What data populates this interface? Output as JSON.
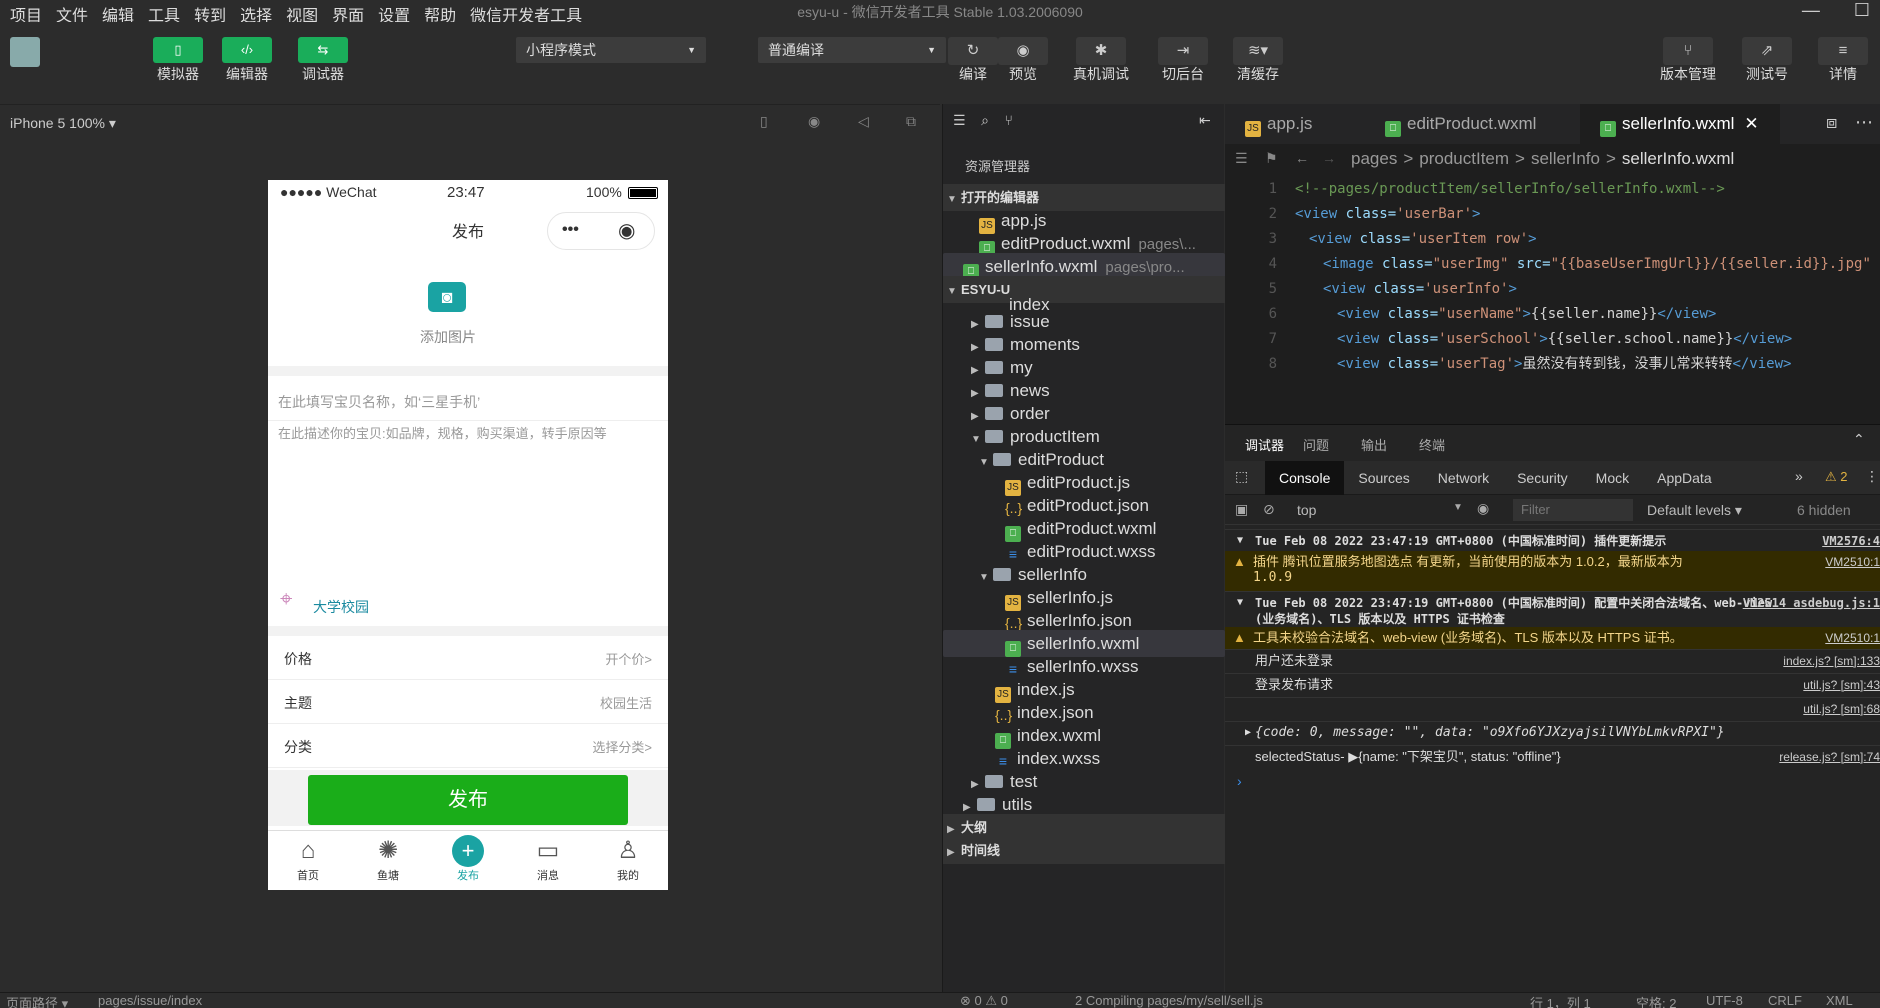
{
  "menubar": {
    "items": [
      "项目",
      "文件",
      "编辑",
      "工具",
      "转到",
      "选择",
      "视图",
      "界面",
      "设置",
      "帮助",
      "微信开发者工具"
    ],
    "title": "esyu-u",
    "subtitle": "微信开发者工具 Stable 1.03.2006090"
  },
  "toolbar": {
    "simulator": "模拟器",
    "editor": "编辑器",
    "debugger": "调试器",
    "mode_select": "小程序模式",
    "compile_select": "普通编译",
    "compile": "编译",
    "preview": "预览",
    "remote_debug": "真机调试",
    "background": "切后台",
    "clear_cache": "清缓存",
    "version": "版本管理",
    "test": "测试号",
    "details": "详情"
  },
  "simulator": {
    "device": "iPhone 5 100% ▾"
  },
  "phone": {
    "carrier": "●●●●● WeChat",
    "time": "23:47",
    "battery": "100%",
    "nav_title": "发布",
    "add_image": "添加图片",
    "title_placeholder": "在此填写宝贝名称，如‘三星手机’",
    "desc_placeholder": "在此描述你的宝贝:如品牌，规格，购买渠道，转手原因等",
    "location": "大学校园",
    "rows": [
      {
        "label": "价格",
        "value": "开个价>"
      },
      {
        "label": "主题",
        "value": "校园生活"
      },
      {
        "label": "分类",
        "value": "选择分类>"
      }
    ],
    "publish": "发布",
    "tabbar": [
      "首页",
      "鱼塘",
      "发布",
      "消息",
      "我的"
    ]
  },
  "explorer": {
    "header": "资源管理器",
    "open_editors": "打开的编辑器",
    "open_files": [
      {
        "name": "app.js",
        "path": ""
      },
      {
        "name": "editProduct.wxml",
        "path": "pages\\..."
      },
      {
        "name": "sellerInfo.wxml",
        "path": "pages\\pro..."
      }
    ],
    "project": "ESYU-U",
    "partial": "index",
    "folders": [
      "issue",
      "moments",
      "my",
      "news",
      "order"
    ],
    "productItem": "productItem",
    "editProduct": "editProduct",
    "ep_files": [
      "editProduct.js",
      "editProduct.json",
      "editProduct.wxml",
      "editProduct.wxss"
    ],
    "sellerInfo": "sellerInfo",
    "si_files": [
      "sellerInfo.js",
      "sellerInfo.json",
      "sellerInfo.wxml",
      "sellerInfo.wxss"
    ],
    "pi_files": [
      "index.js",
      "index.json",
      "index.wxml",
      "index.wxss"
    ],
    "test": "test",
    "utils": "utils",
    "outline": "大纲",
    "timeline": "时间线"
  },
  "editor": {
    "tabs": [
      "app.js",
      "editProduct.wxml",
      "sellerInfo.wxml"
    ],
    "breadcrumb": [
      "pages",
      "productItem",
      "sellerInfo",
      "sellerInfo.wxml"
    ],
    "lines": [
      {
        "n": "1",
        "ind": 0,
        "parts": [
          [
            "cmt",
            "<!--pages/productItem/sellerInfo/sellerInfo.wxml-->"
          ]
        ]
      },
      {
        "n": "2",
        "ind": 0,
        "parts": [
          [
            "tag",
            "<view "
          ],
          [
            "attr",
            "class="
          ],
          [
            "str",
            "'userBar'"
          ],
          [
            "tag",
            ">"
          ]
        ]
      },
      {
        "n": "3",
        "ind": 1,
        "parts": [
          [
            "tag",
            "<view "
          ],
          [
            "attr",
            "class="
          ],
          [
            "str",
            "'userItem row'"
          ],
          [
            "tag",
            ">"
          ]
        ]
      },
      {
        "n": "4",
        "ind": 2,
        "parts": [
          [
            "tag",
            "<image "
          ],
          [
            "attr",
            "class="
          ],
          [
            "str",
            "\"userImg\" "
          ],
          [
            "attr",
            "src="
          ],
          [
            "str",
            "\"{{baseUserImgUrl}}/{{seller.id}}.jpg\""
          ]
        ]
      },
      {
        "n": "5",
        "ind": 2,
        "parts": [
          [
            "tag",
            "<view "
          ],
          [
            "attr",
            "class="
          ],
          [
            "str",
            "'userInfo'"
          ],
          [
            "tag",
            ">"
          ]
        ]
      },
      {
        "n": "6",
        "ind": 3,
        "parts": [
          [
            "tag",
            "<view "
          ],
          [
            "attr",
            "class="
          ],
          [
            "str",
            "\"userName\""
          ],
          [
            "tag",
            ">"
          ],
          [
            "txt",
            "{{seller.name}}"
          ],
          [
            "tag",
            "</view>"
          ]
        ]
      },
      {
        "n": "7",
        "ind": 3,
        "parts": [
          [
            "tag",
            "<view "
          ],
          [
            "attr",
            "class="
          ],
          [
            "str",
            "'userSchool'"
          ],
          [
            "tag",
            ">"
          ],
          [
            "txt",
            "{{seller.school.name}}"
          ],
          [
            "tag",
            "</view>"
          ]
        ]
      },
      {
        "n": "8",
        "ind": 3,
        "parts": [
          [
            "tag",
            "<view "
          ],
          [
            "attr",
            "class="
          ],
          [
            "str",
            "'userTag'"
          ],
          [
            "tag",
            ">"
          ],
          [
            "txt",
            "虽然没有转到钱，没事儿常来转转"
          ],
          [
            "tag",
            "</view>"
          ]
        ]
      }
    ]
  },
  "devtools": {
    "top_tabs": [
      "调试器",
      "问题",
      "输出",
      "终端"
    ],
    "tabs": [
      "Console",
      "Sources",
      "Network",
      "Security",
      "Mock",
      "AppData"
    ],
    "warn_count": "2",
    "context": "top",
    "filter_placeholder": "Filter",
    "levels": "Default levels ▾",
    "hidden": "6 hidden",
    "logs": [
      {
        "type": "group",
        "text": "Tue Feb 08 2022 23:47:19 GMT+0800 (中国标准时间) 插件更新提示",
        "src": "VM2576:4"
      },
      {
        "type": "warn",
        "text": "插件 腾讯位置服务地图选点 有更新，当前使用的版本为 1.0.2，最新版本为",
        "extra": "1.0.9",
        "src": "VM2510:1"
      },
      {
        "type": "group",
        "text": "Tue Feb 08 2022 23:47:19 GMT+0800 (中国标准时间) 配置中关闭合法域名、web-view (业务域名)、TLS 版本以及 HTTPS 证书检查",
        "src": "VM2514 asdebug.js:1"
      },
      {
        "type": "warn",
        "text": "工具未校验合法域名、web-view (业务域名)、TLS 版本以及 HTTPS 证书。",
        "src": "VM2510:1"
      },
      {
        "type": "log",
        "text": "用户还未登录",
        "src": "index.js? [sm]:133"
      },
      {
        "type": "log",
        "text": "登录发布请求",
        "src": "util.js? [sm]:43"
      },
      {
        "type": "log",
        "text": "",
        "src": "util.js? [sm]:68"
      },
      {
        "type": "obj",
        "text": "{code: 0, message: \"\", data: \"o9Xfo6YJXzyajsilVNYbLmkvRPXI\"}",
        "src": ""
      },
      {
        "type": "log",
        "text": "selectedStatus-  ▶{name: \"下架宝贝\", status: \"offline\"}",
        "src": "release.js? [sm]:74"
      }
    ]
  },
  "statusbar": {
    "path_label": "页面路径 ▾",
    "path": "pages/issue/index",
    "errors": "⊗ 0 ⚠ 0",
    "compiling": "2 Compiling pages/my/sell/sell.js",
    "line": "行 1，列 1",
    "spaces": "空格: 2",
    "enc": "UTF-8",
    "eol": "CRLF",
    "lang": "XML"
  },
  "colors": {
    "accent": "#1aad19",
    "brand_green": "#1aad5a",
    "warn": "#f4d68b"
  }
}
